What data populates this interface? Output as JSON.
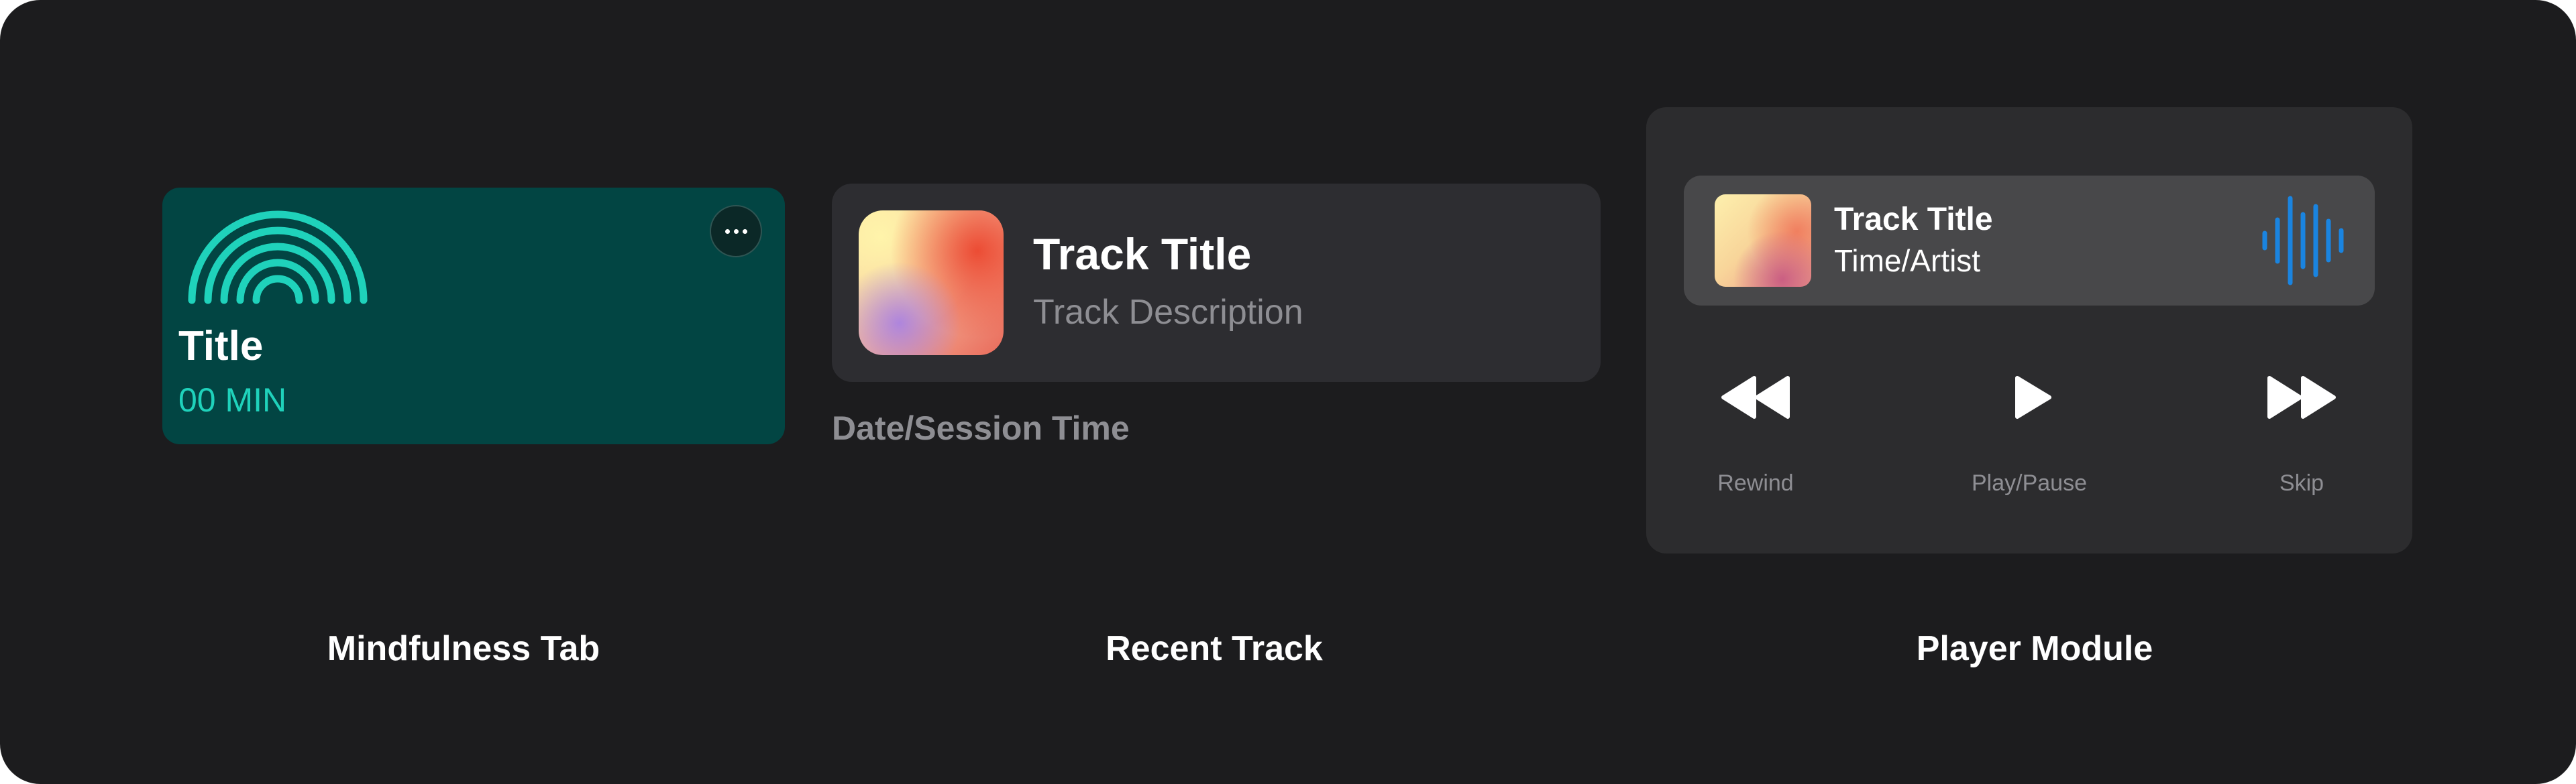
{
  "colors": {
    "background": "#1c1c1e",
    "mind_card": "#024543",
    "mind_accent": "#1fd2bb",
    "card_dark": "#2d2d31",
    "player_panel": "#2c2c2e",
    "now_playing_bar": "#48484a",
    "secondary_text": "#8e8e93",
    "waveform": "#1a84e0"
  },
  "mindfulness_tab": {
    "title": "Title",
    "duration": "00 MIN",
    "icon": "rainbow-arcs-icon",
    "more_icon": "ellipsis-icon",
    "section_label": "Mindfulness Tab"
  },
  "recent_track": {
    "title": "Track Title",
    "description": "Track Description",
    "date_session": "Date/Session Time",
    "section_label": "Recent Track"
  },
  "player_module": {
    "now_playing": {
      "title": "Track Title",
      "subtitle": "Time/Artist",
      "icon": "waveform-icon"
    },
    "controls": [
      {
        "label": "Rewind",
        "icon": "rewind-icon"
      },
      {
        "label": "Play/Pause",
        "icon": "play-icon"
      },
      {
        "label": "Skip",
        "icon": "fast-forward-icon"
      }
    ],
    "section_label": "Player Module"
  }
}
